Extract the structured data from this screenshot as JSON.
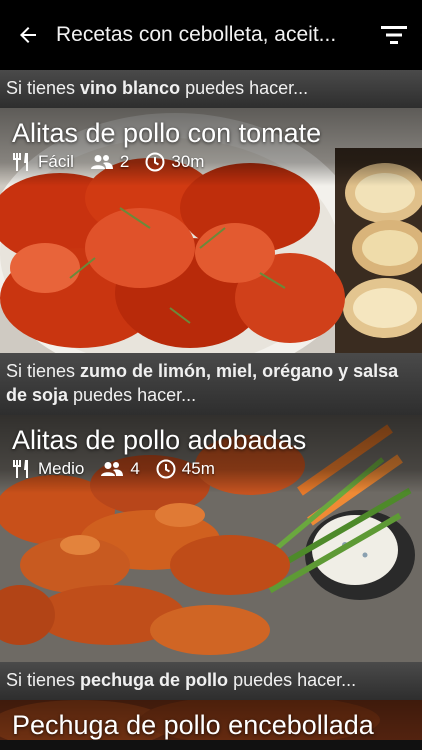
{
  "header": {
    "title": "Recetas con cebolleta, aceit..."
  },
  "sections": [
    {
      "prefix": "Si tienes ",
      "ingredients": "vino blanco",
      "suffix": " puedes hacer...",
      "recipe": {
        "title": "Alitas de pollo con tomate",
        "difficulty": "Fácil",
        "servings": "2",
        "time": "30m"
      }
    },
    {
      "prefix": "Si tienes ",
      "ingredients": "zumo de limón, miel, orégano y salsa de soja",
      "suffix": " puedes hacer...",
      "recipe": {
        "title": "Alitas de pollo adobadas",
        "difficulty": "Medio",
        "servings": "4",
        "time": "45m"
      }
    },
    {
      "prefix": "Si tienes ",
      "ingredients": "pechuga de pollo",
      "suffix": " puedes hacer...",
      "recipe": {
        "title": "Pechuga de pollo encebollada"
      }
    }
  ],
  "colors": {
    "topbar": "#000000",
    "section_bg": "#3a3a3a",
    "sauce": "#c8320f"
  },
  "icons": [
    "back-arrow-icon",
    "filter-icon",
    "utensils-icon",
    "people-icon",
    "clock-icon"
  ]
}
